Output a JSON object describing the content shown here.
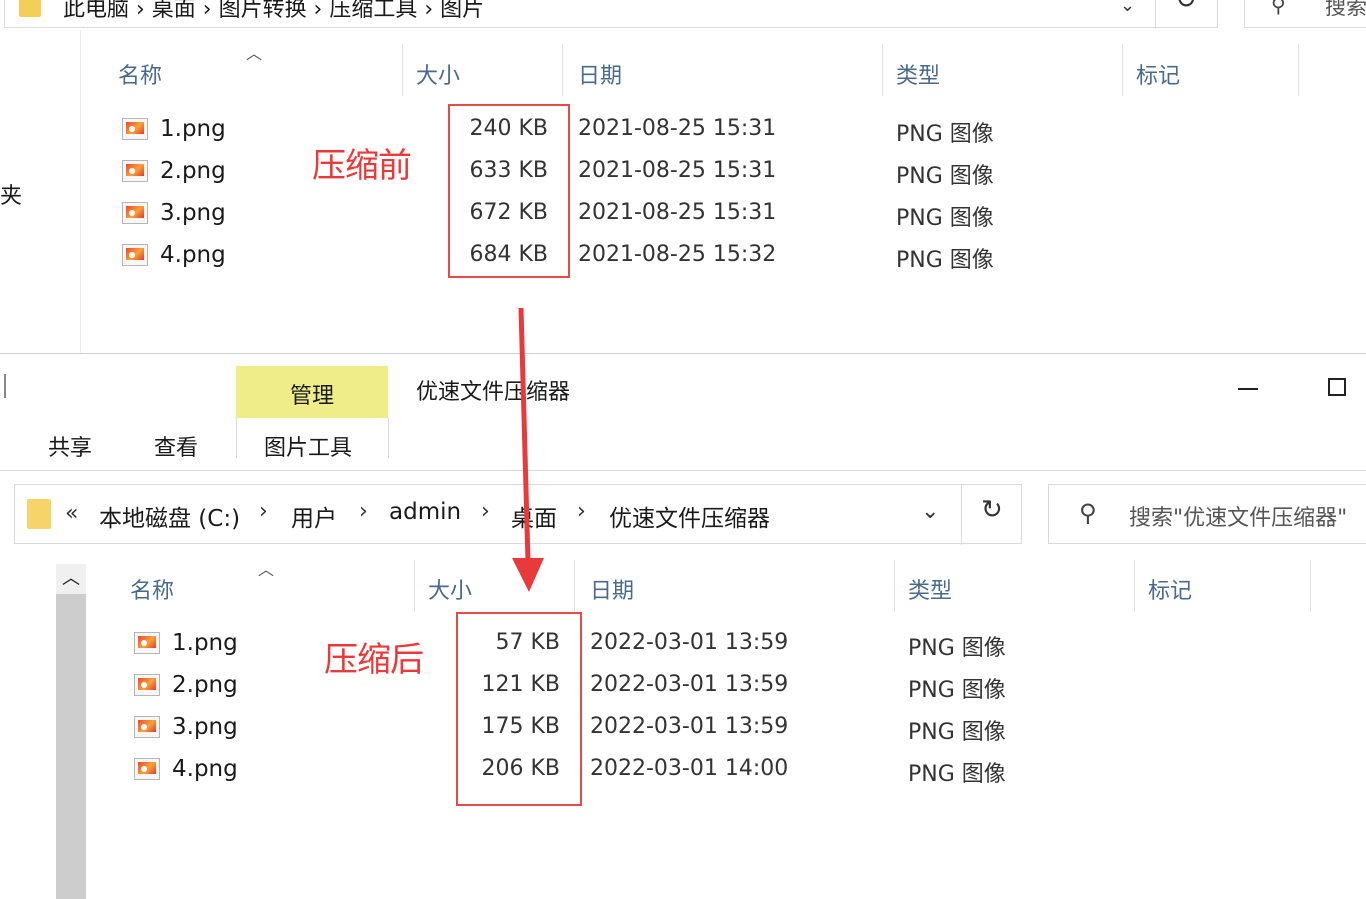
{
  "top_window": {
    "address_crumbs": "此电脑  ›  桌面  ›  图片转换  ›  压缩工具  ›  图片",
    "search_text": "搜索",
    "nav_partial_text": "夹",
    "headers": {
      "name": "名称",
      "size": "大小",
      "date": "日期",
      "type": "类型",
      "tags": "标记"
    },
    "annotation_label": "压缩前",
    "files": [
      {
        "name": "1.png",
        "size": "240 KB",
        "date": "2021-08-25 15:31",
        "type": "PNG 图像"
      },
      {
        "name": "2.png",
        "size": "633 KB",
        "date": "2021-08-25 15:31",
        "type": "PNG 图像"
      },
      {
        "name": "3.png",
        "size": "672 KB",
        "date": "2021-08-25 15:31",
        "type": "PNG 图像"
      },
      {
        "name": "4.png",
        "size": "684 KB",
        "date": "2021-08-25 15:32",
        "type": "PNG 图像"
      }
    ]
  },
  "bottom_window": {
    "manage_tab": "管理",
    "title": "优速文件压缩器",
    "ribbon_tabs": {
      "share": "共享",
      "view": "查看",
      "picture_tools": "图片工具"
    },
    "address": {
      "back": "«",
      "crumbs": [
        "本地磁盘 (C:)",
        "用户",
        "admin",
        "桌面",
        "优速文件压缩器"
      ],
      "separator": "›"
    },
    "search_placeholder": "搜索\"优速文件压缩器\"",
    "headers": {
      "name": "名称",
      "size": "大小",
      "date": "日期",
      "type": "类型",
      "tags": "标记"
    },
    "annotation_label": "压缩后",
    "files": [
      {
        "name": "1.png",
        "size": "57 KB",
        "date": "2022-03-01 13:59",
        "type": "PNG 图像"
      },
      {
        "name": "2.png",
        "size": "121 KB",
        "date": "2022-03-01 13:59",
        "type": "PNG 图像"
      },
      {
        "name": "3.png",
        "size": "175 KB",
        "date": "2022-03-01 13:59",
        "type": "PNG 图像"
      },
      {
        "name": "4.png",
        "size": "206 KB",
        "date": "2022-03-01 14:00",
        "type": "PNG 图像"
      }
    ]
  },
  "colors": {
    "annotation_red": "#e84a4a",
    "manage_tab_bg": "#eeed8a",
    "folder_yellow": "#f6d469",
    "header_text": "#4a6a8a"
  },
  "icons": {
    "folder": "folder-icon",
    "image_file": "png-file-icon",
    "refresh": "refresh-icon",
    "search": "search-icon",
    "dropdown": "chevron-down-icon",
    "sort": "sort-caret-icon",
    "minimize": "minimize-icon",
    "maximize": "maximize-icon"
  }
}
